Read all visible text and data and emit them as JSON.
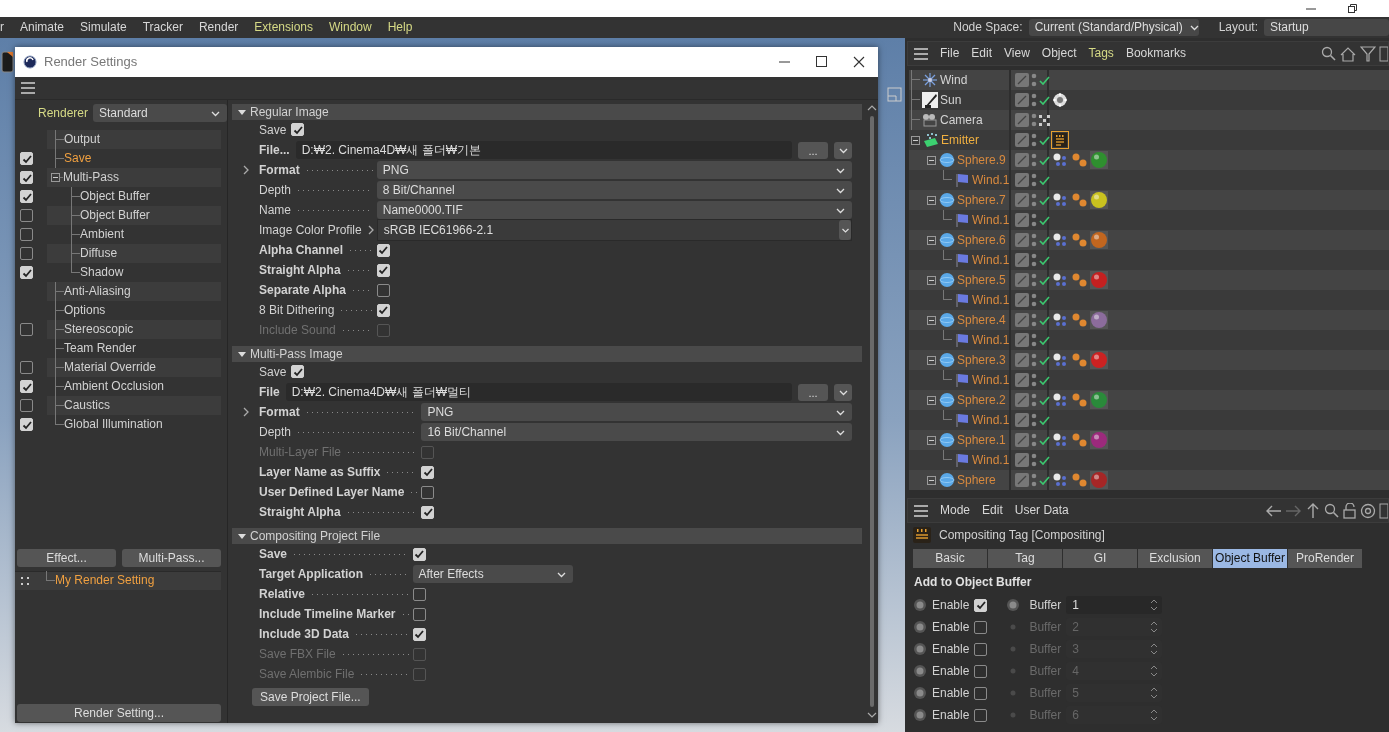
{
  "menu_bar": {
    "items": [
      {
        "label": "r",
        "highlighted": false
      },
      {
        "label": "Animate",
        "highlighted": false
      },
      {
        "label": "Simulate",
        "highlighted": false
      },
      {
        "label": "Tracker",
        "highlighted": false
      },
      {
        "label": "Render",
        "highlighted": false
      },
      {
        "label": "Extensions",
        "highlighted": true
      },
      {
        "label": "Window",
        "highlighted": true
      },
      {
        "label": "Help",
        "highlighted": true
      }
    ],
    "node_space": {
      "label": "Node Space:",
      "value": "Current (Standard/Physical)"
    },
    "layout": {
      "label": "Layout:",
      "value": "Startup"
    }
  },
  "render_settings": {
    "title": "Render Settings",
    "renderer": {
      "label": "Renderer",
      "value": "Standard"
    },
    "tree": [
      {
        "label": "Output",
        "kind": "plain",
        "selected": false
      },
      {
        "label": "Save",
        "kind": "check",
        "checked": true,
        "selected": true
      },
      {
        "label": "Multi-Pass",
        "kind": "check",
        "checked": true,
        "selected": false,
        "expanded": true,
        "children": [
          {
            "label": "Object Buffer",
            "kind": "check",
            "checked": true,
            "selected": false
          },
          {
            "label": "Object Buffer",
            "kind": "check",
            "checked": false,
            "selected": false
          },
          {
            "label": "Ambient",
            "kind": "check",
            "checked": false,
            "selected": false
          },
          {
            "label": "Diffuse",
            "kind": "check",
            "checked": false,
            "selected": false
          },
          {
            "label": "Shadow",
            "kind": "check",
            "checked": true,
            "selected": false
          }
        ]
      },
      {
        "label": "Anti-Aliasing",
        "kind": "plain",
        "selected": false
      },
      {
        "label": "Options",
        "kind": "plain",
        "selected": false
      },
      {
        "label": "Stereoscopic",
        "kind": "check",
        "checked": false,
        "selected": false
      },
      {
        "label": "Team Render",
        "kind": "plain",
        "selected": false
      },
      {
        "label": "Material Override",
        "kind": "check",
        "checked": false,
        "selected": false
      },
      {
        "label": "Ambient Occlusion",
        "kind": "check",
        "checked": true,
        "selected": false
      },
      {
        "label": "Caustics",
        "kind": "check",
        "checked": false,
        "selected": false
      },
      {
        "label": "Global Illumination",
        "kind": "check",
        "checked": true,
        "selected": false
      }
    ],
    "effect_buttons": [
      "Effect...",
      "Multi-Pass..."
    ],
    "presets": [
      {
        "label": "My Render Setting",
        "selected": true
      }
    ],
    "render_setting_button": "Render Setting...",
    "sections": [
      {
        "title": "Regular Image",
        "expanded": true,
        "rows": [
          {
            "kind": "inline_check",
            "label": "Save",
            "checked": true,
            "bold": false,
            "disabled": false
          },
          {
            "kind": "file",
            "label": "File...",
            "value": "D:₩2. Cinema4D₩새 폴더₩기본",
            "browse": "..."
          },
          {
            "kind": "select",
            "label": "Format",
            "value": "PNG",
            "bold": true,
            "expandable": true
          },
          {
            "kind": "select",
            "label": "Depth",
            "value": "8 Bit/Channel",
            "bold": false
          },
          {
            "kind": "select",
            "label": "Name",
            "value": "Name0000.TIF",
            "bold": false
          },
          {
            "kind": "profile",
            "label": "Image Color Profile",
            "value": "sRGB IEC61966-2.1"
          },
          {
            "kind": "check",
            "label": "Alpha Channel",
            "checked": true,
            "bold": true,
            "disabled": false
          },
          {
            "kind": "check",
            "label": "Straight Alpha",
            "checked": true,
            "bold": true,
            "disabled": false
          },
          {
            "kind": "check",
            "label": "Separate Alpha",
            "checked": false,
            "bold": true,
            "disabled": false
          },
          {
            "kind": "check",
            "label": "8 Bit Dithering",
            "checked": true,
            "bold": false,
            "disabled": false
          },
          {
            "kind": "check",
            "label": "Include Sound",
            "checked": false,
            "bold": false,
            "disabled": true
          }
        ]
      },
      {
        "title": "Multi-Pass Image",
        "expanded": true,
        "rows": [
          {
            "kind": "inline_check",
            "label": "Save",
            "checked": true,
            "bold": false,
            "disabled": false
          },
          {
            "kind": "file",
            "label": "File",
            "value": "D:₩2. Cinema4D₩새 폴더₩멀티",
            "browse": "..."
          },
          {
            "kind": "select",
            "label": "Format",
            "value": "PNG",
            "bold": true,
            "expandable": true
          },
          {
            "kind": "select",
            "label": "Depth",
            "value": "16 Bit/Channel",
            "bold": false
          },
          {
            "kind": "check",
            "label": "Multi-Layer File",
            "checked": false,
            "bold": false,
            "disabled": true
          },
          {
            "kind": "check",
            "label": "Layer Name as Suffix",
            "checked": true,
            "bold": true,
            "disabled": false
          },
          {
            "kind": "check",
            "label": "User Defined Layer Name",
            "checked": false,
            "bold": true,
            "disabled": false
          },
          {
            "kind": "check",
            "label": "Straight Alpha",
            "checked": true,
            "bold": true,
            "disabled": false
          }
        ]
      },
      {
        "title": "Compositing Project File",
        "expanded": true,
        "rows": [
          {
            "kind": "check",
            "label": "Save",
            "checked": true,
            "bold": true,
            "disabled": false
          },
          {
            "kind": "short_select",
            "label": "Target Application",
            "value": "After Effects",
            "bold": true
          },
          {
            "kind": "check",
            "label": "Relative",
            "checked": false,
            "bold": true,
            "disabled": false
          },
          {
            "kind": "check",
            "label": "Include Timeline Marker",
            "checked": false,
            "bold": true,
            "disabled": false
          },
          {
            "kind": "check",
            "label": "Include 3D Data",
            "checked": true,
            "bold": true,
            "disabled": false
          },
          {
            "kind": "check",
            "label": "Save FBX File",
            "checked": false,
            "bold": false,
            "disabled": true
          },
          {
            "kind": "check",
            "label": "Save Alembic File",
            "checked": false,
            "bold": false,
            "disabled": true
          }
        ]
      }
    ],
    "save_project_button": "Save Project File..."
  },
  "object_manager": {
    "menu": [
      {
        "label": "File",
        "highlighted": false
      },
      {
        "label": "Edit",
        "highlighted": false
      },
      {
        "label": "View",
        "highlighted": false
      },
      {
        "label": "Object",
        "highlighted": false
      },
      {
        "label": "Tags",
        "highlighted": true
      },
      {
        "label": "Bookmarks",
        "highlighted": false
      }
    ],
    "objects": [
      {
        "name": "Wind",
        "kind": "wind",
        "checked": true,
        "color": "#d4d4d4"
      },
      {
        "name": "Sun",
        "kind": "sun",
        "checked": true,
        "color": "#d4d4d4",
        "tags": [
          {
            "kind": "light",
            "selected": false
          }
        ]
      },
      {
        "name": "Camera",
        "kind": "camera",
        "checked": false,
        "color": "#d4d4d4"
      },
      {
        "name": "Emitter",
        "kind": "emitter",
        "checked": true,
        "color": "#f0b040",
        "expanded": true,
        "tags": [
          {
            "kind": "compositing",
            "selected": true
          }
        ],
        "children": [
          {
            "name": "Sphere.9",
            "kind": "sphere",
            "checked": true,
            "color": "#d8893e",
            "expanded": true,
            "tags": [
              {
                "kind": "particle",
                "selected": false
              },
              {
                "kind": "dynamics",
                "selected": false
              },
              {
                "kind": "material",
                "color": "#2f8f2f",
                "selected": false
              }
            ],
            "children": [
              {
                "name": "Wind.1",
                "kind": "deformer",
                "checked": true,
                "color": "#d8893e"
              }
            ]
          },
          {
            "name": "Sphere.7",
            "kind": "sphere",
            "checked": true,
            "color": "#d8893e",
            "expanded": true,
            "tags": [
              {
                "kind": "particle",
                "selected": false
              },
              {
                "kind": "dynamics",
                "selected": false
              },
              {
                "kind": "material",
                "color": "#c9c21f",
                "selected": false
              }
            ],
            "children": [
              {
                "name": "Wind.1",
                "kind": "deformer",
                "checked": true,
                "color": "#d8893e"
              }
            ]
          },
          {
            "name": "Sphere.6",
            "kind": "sphere",
            "checked": true,
            "color": "#d8893e",
            "expanded": true,
            "tags": [
              {
                "kind": "particle",
                "selected": false
              },
              {
                "kind": "dynamics",
                "selected": false
              },
              {
                "kind": "material",
                "color": "#c2661f",
                "selected": false
              }
            ],
            "children": [
              {
                "name": "Wind.1",
                "kind": "deformer",
                "checked": true,
                "color": "#d8893e"
              }
            ]
          },
          {
            "name": "Sphere.5",
            "kind": "sphere",
            "checked": true,
            "color": "#d8893e",
            "expanded": true,
            "tags": [
              {
                "kind": "particle",
                "selected": false
              },
              {
                "kind": "dynamics",
                "selected": false
              },
              {
                "kind": "material",
                "color": "#c42020",
                "selected": false
              }
            ],
            "children": [
              {
                "name": "Wind.1",
                "kind": "deformer",
                "checked": true,
                "color": "#d8893e"
              }
            ]
          },
          {
            "name": "Sphere.4",
            "kind": "sphere",
            "checked": true,
            "color": "#d8893e",
            "expanded": true,
            "tags": [
              {
                "kind": "particle",
                "selected": false
              },
              {
                "kind": "dynamics",
                "selected": false
              },
              {
                "kind": "material",
                "color": "#8c6c9c",
                "selected": false
              }
            ],
            "children": [
              {
                "name": "Wind.1",
                "kind": "deformer",
                "checked": true,
                "color": "#d8893e"
              }
            ]
          },
          {
            "name": "Sphere.3",
            "kind": "sphere",
            "checked": true,
            "color": "#d8893e",
            "expanded": true,
            "tags": [
              {
                "kind": "particle",
                "selected": false
              },
              {
                "kind": "dynamics",
                "selected": false
              },
              {
                "kind": "material",
                "color": "#cc2222",
                "selected": false
              }
            ],
            "children": [
              {
                "name": "Wind.1",
                "kind": "deformer",
                "checked": true,
                "color": "#d8893e"
              }
            ]
          },
          {
            "name": "Sphere.2",
            "kind": "sphere",
            "checked": true,
            "color": "#d8893e",
            "expanded": true,
            "tags": [
              {
                "kind": "particle",
                "selected": false
              },
              {
                "kind": "dynamics",
                "selected": false
              },
              {
                "kind": "material",
                "color": "#2a8a3a",
                "selected": false
              }
            ],
            "children": [
              {
                "name": "Wind.1",
                "kind": "deformer",
                "checked": true,
                "color": "#d8893e"
              }
            ]
          },
          {
            "name": "Sphere.1",
            "kind": "sphere",
            "checked": true,
            "color": "#d8893e",
            "expanded": true,
            "tags": [
              {
                "kind": "particle",
                "selected": false
              },
              {
                "kind": "dynamics",
                "selected": false
              },
              {
                "kind": "material",
                "color": "#9c2a7c",
                "selected": false
              }
            ],
            "children": [
              {
                "name": "Wind.1",
                "kind": "deformer",
                "checked": true,
                "color": "#d8893e"
              }
            ]
          },
          {
            "name": "Sphere",
            "kind": "sphere",
            "checked": true,
            "color": "#d8893e",
            "expanded": true,
            "tags": [
              {
                "kind": "particle",
                "selected": false
              },
              {
                "kind": "dynamics",
                "selected": false
              },
              {
                "kind": "material",
                "color": "#a62626",
                "selected": false
              }
            ]
          }
        ]
      }
    ]
  },
  "attributes": {
    "menu": [
      "Mode",
      "Edit",
      "User Data"
    ],
    "title": "Compositing Tag [Compositing]",
    "tabs": [
      {
        "label": "Basic",
        "selected": false
      },
      {
        "label": "Tag",
        "selected": false
      },
      {
        "label": "GI",
        "selected": false
      },
      {
        "label": "Exclusion",
        "selected": false
      },
      {
        "label": "Object Buffer",
        "selected": true
      },
      {
        "label": "ProRender",
        "selected": false
      }
    ],
    "group_title": "Add to Object Buffer",
    "buffers": [
      {
        "enable_label": "Enable",
        "enabled": true,
        "buffer_label": "Buffer",
        "value": "1"
      },
      {
        "enable_label": "Enable",
        "enabled": false,
        "buffer_label": "Buffer",
        "value": "2"
      },
      {
        "enable_label": "Enable",
        "enabled": false,
        "buffer_label": "Buffer",
        "value": "3"
      },
      {
        "enable_label": "Enable",
        "enabled": false,
        "buffer_label": "Buffer",
        "value": "4"
      },
      {
        "enable_label": "Enable",
        "enabled": false,
        "buffer_label": "Buffer",
        "value": "5"
      },
      {
        "enable_label": "Enable",
        "enabled": false,
        "buffer_label": "Buffer",
        "value": "6"
      }
    ]
  }
}
